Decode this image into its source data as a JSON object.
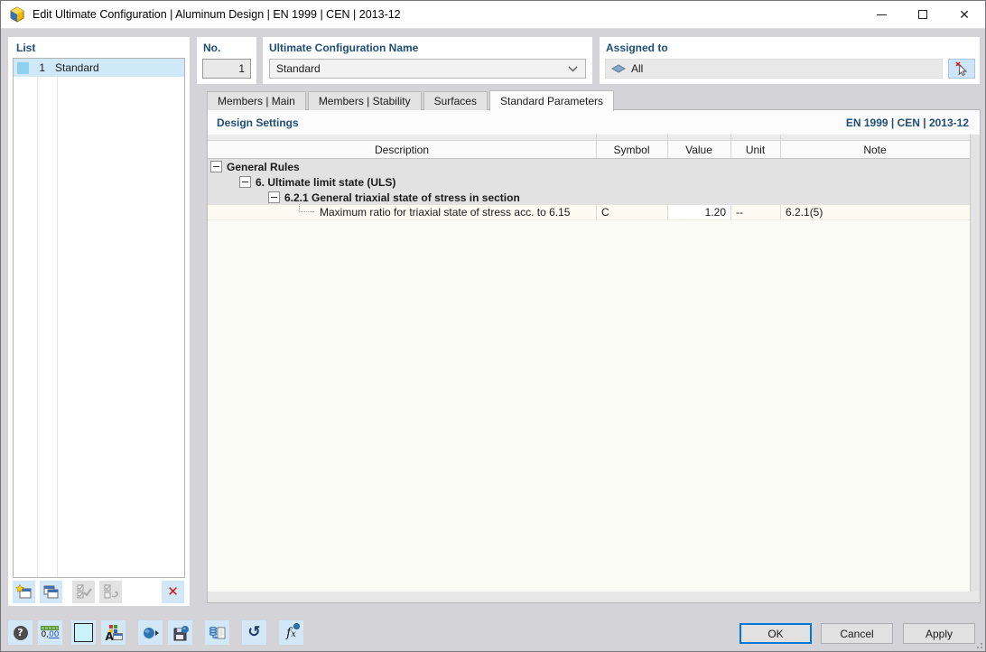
{
  "window": {
    "title": "Edit Ultimate Configuration | Aluminum Design | EN 1999 | CEN | 2013-12"
  },
  "list_panel": {
    "label": "List",
    "rows": [
      {
        "no": "1",
        "name": "Standard"
      }
    ]
  },
  "config": {
    "no_label": "No.",
    "no_value": "1",
    "name_label": "Ultimate Configuration Name",
    "name_value": "Standard",
    "assigned_label": "Assigned to",
    "assigned_value": "All"
  },
  "tabs": [
    {
      "label": "Members | Main",
      "active": false
    },
    {
      "label": "Members | Stability",
      "active": false
    },
    {
      "label": "Surfaces",
      "active": false
    },
    {
      "label": "Standard Parameters",
      "active": true
    }
  ],
  "design": {
    "section_title": "Design Settings",
    "standard_ref": "EN 1999 | CEN | 2013-12",
    "columns": {
      "description": "Description",
      "symbol": "Symbol",
      "value": "Value",
      "unit": "Unit",
      "note": "Note"
    },
    "rows": [
      {
        "level": 0,
        "label": "General Rules",
        "type": "group"
      },
      {
        "level": 1,
        "label": "6. Ultimate limit state (ULS)",
        "type": "group"
      },
      {
        "level": 2,
        "label": "6.2.1 General triaxial state of stress in section",
        "type": "group"
      },
      {
        "level": 3,
        "label": "Maximum ratio for triaxial state of stress acc. to 6.15",
        "type": "param",
        "symbol": "C",
        "value": "1.20",
        "unit": "--",
        "note": "6.2.1(5)"
      }
    ]
  },
  "footer": {
    "ok": "OK",
    "cancel": "Cancel",
    "apply": "Apply"
  },
  "icons": {
    "help": "?",
    "units_main": "0,",
    "units_decimals": "00",
    "font_letter": "A",
    "reset": "↺",
    "formula_f": "f",
    "formula_x": "x",
    "delete": "✕",
    "list_toolbar": [
      "new-configuration-icon",
      "copy-configuration-icon",
      "select-all-icon",
      "deselect-icon",
      "delete-icon"
    ],
    "main_toolbar": [
      "help-icon",
      "units-icon",
      "color-swatch-icon",
      "font-icon",
      "transfer-icon",
      "save-icon",
      "import-icon",
      "reset-icon",
      "formula-icon"
    ]
  },
  "colors": {
    "label_blue": "#1f4e79",
    "selection_blue": "#cfe9f8",
    "swatch_blue": "#8fd2ef",
    "toolbar_button_blue": "#d2e8f7",
    "ok_border_blue": "#0078d7",
    "delete_red": "#dd1111",
    "group_row_grey": "#e2e2e2",
    "param_row_cream": "#fbfbf2"
  }
}
